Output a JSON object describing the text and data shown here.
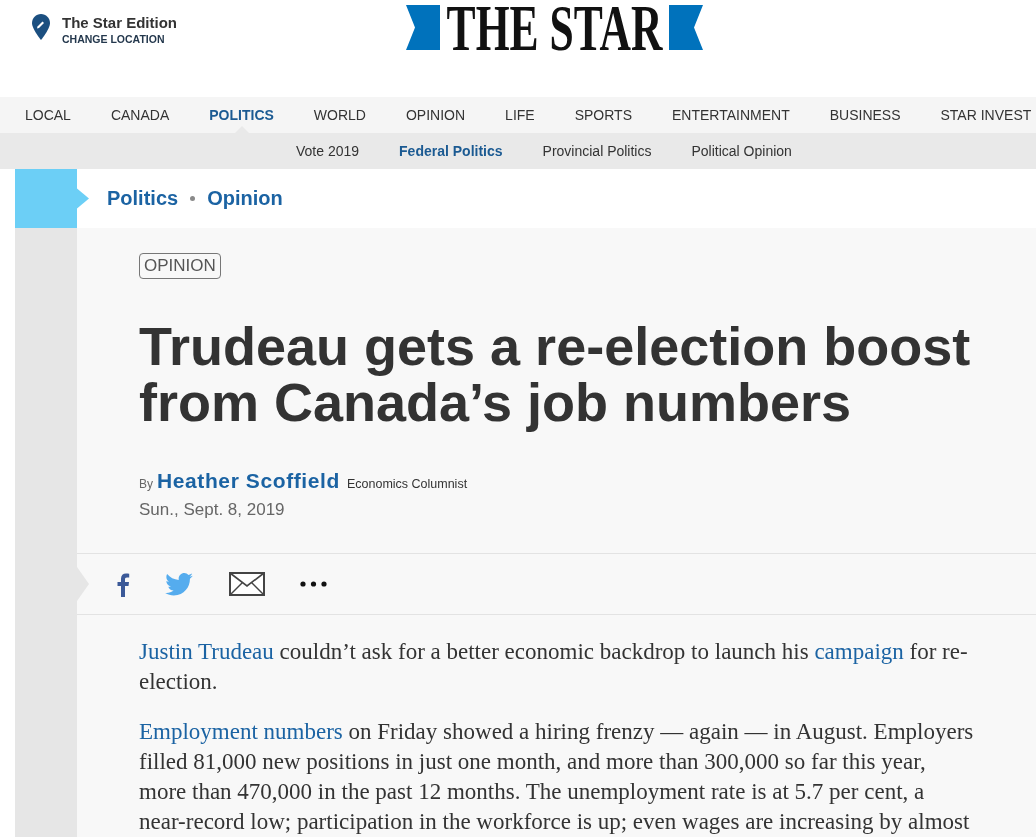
{
  "edition": {
    "title": "The Star Edition",
    "action": "CHANGE LOCATION"
  },
  "logo": {
    "text": "THE STAR"
  },
  "nav": {
    "items": [
      {
        "label": "LOCAL",
        "selected": false
      },
      {
        "label": "CANADA",
        "selected": false
      },
      {
        "label": "POLITICS",
        "selected": true
      },
      {
        "label": "WORLD",
        "selected": false
      },
      {
        "label": "OPINION",
        "selected": false
      },
      {
        "label": "LIFE",
        "selected": false
      },
      {
        "label": "SPORTS",
        "selected": false
      },
      {
        "label": "ENTERTAINMENT",
        "selected": false
      },
      {
        "label": "BUSINESS",
        "selected": false
      },
      {
        "label": "STAR INVEST",
        "selected": false
      }
    ]
  },
  "subnav": {
    "items": [
      {
        "label": "Vote 2019",
        "selected": false
      },
      {
        "label": "Federal Politics",
        "selected": true
      },
      {
        "label": "Provincial Politics",
        "selected": false
      },
      {
        "label": "Political Opinion",
        "selected": false
      }
    ]
  },
  "section": {
    "crumbs": [
      "Politics",
      "Opinion"
    ]
  },
  "article": {
    "label": "OPINION",
    "headline": "Trudeau gets a re-election boost from Canada’s job numbers",
    "byline": {
      "prefix": "By",
      "author": "Heather Scoffield",
      "role": "Economics Columnist"
    },
    "date": "Sun., Sept. 8, 2019",
    "paragraphs": [
      [
        {
          "kind": "link",
          "text": "Justin Trudeau"
        },
        {
          "kind": "text",
          "text": " couldn’t ask for a better economic backdrop to launch his "
        },
        {
          "kind": "link",
          "text": "campaign"
        },
        {
          "kind": "text",
          "text": " for re-election."
        }
      ],
      [
        {
          "kind": "link",
          "text": "Employment numbers"
        },
        {
          "kind": "text",
          "text": " on Friday showed a hiring frenzy — again — in August. Employers filled 81,000 new positions in just one month, and more than 300,000 so far this year, more than 470,000 in the past 12 months. The unemployment rate is at 5.7 per cent, a near-record low; participation in the workforce is up; even wages are increasing by almost"
        }
      ]
    ]
  }
}
